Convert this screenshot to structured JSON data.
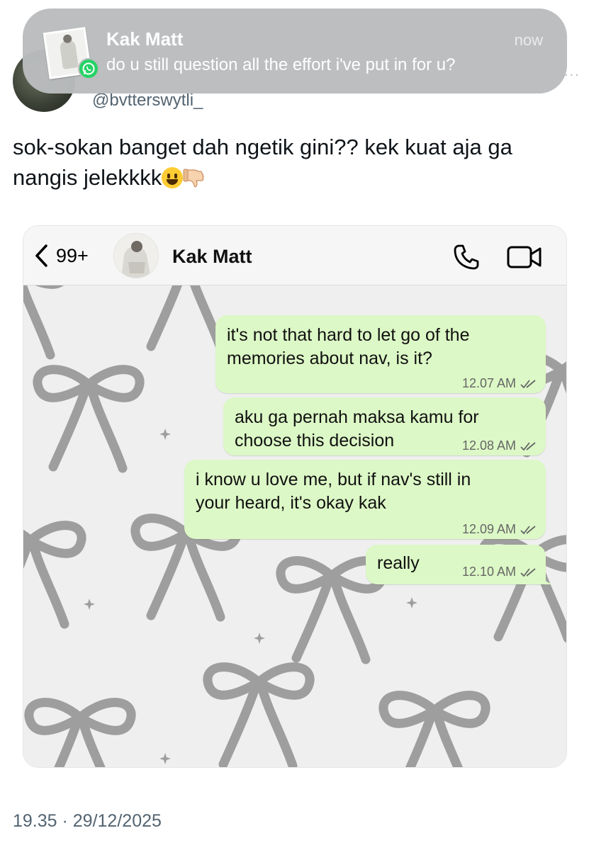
{
  "tweet": {
    "handle": "@bvtterswytli_",
    "text_line1": "sok-sokan banget dah ngetik gini?? kek kuat aja ga",
    "text_line2": "nangis jelekkkk",
    "emojis": [
      "grinning-face",
      "thumbs-down"
    ],
    "timestamp": "19.35 · 29/12/2025"
  },
  "notification": {
    "title": "Kak Matt",
    "message": "do u still question all the effort i've put in for u?",
    "time": "now",
    "app_icon": "whatsapp-icon",
    "more": "..."
  },
  "chat": {
    "back_count": "99+",
    "contact_name": "Kak Matt",
    "messages": [
      {
        "line1": "it's not that hard to let go of the",
        "line2": "memories about nav, is it?",
        "time": "12.07 AM"
      },
      {
        "line1": "aku ga pernah maksa kamu for",
        "line2": "choose this decision",
        "time": "12.08 AM"
      },
      {
        "line1": "i know u love me, but if nav's still in",
        "line2": "your heard, it's okay kak",
        "time": "12.09 AM"
      },
      {
        "line1": "really",
        "line2": "",
        "time": "12.10 AM"
      }
    ],
    "bubble_color": "#dcf8c6",
    "wallpaper": "grey bows pattern"
  }
}
